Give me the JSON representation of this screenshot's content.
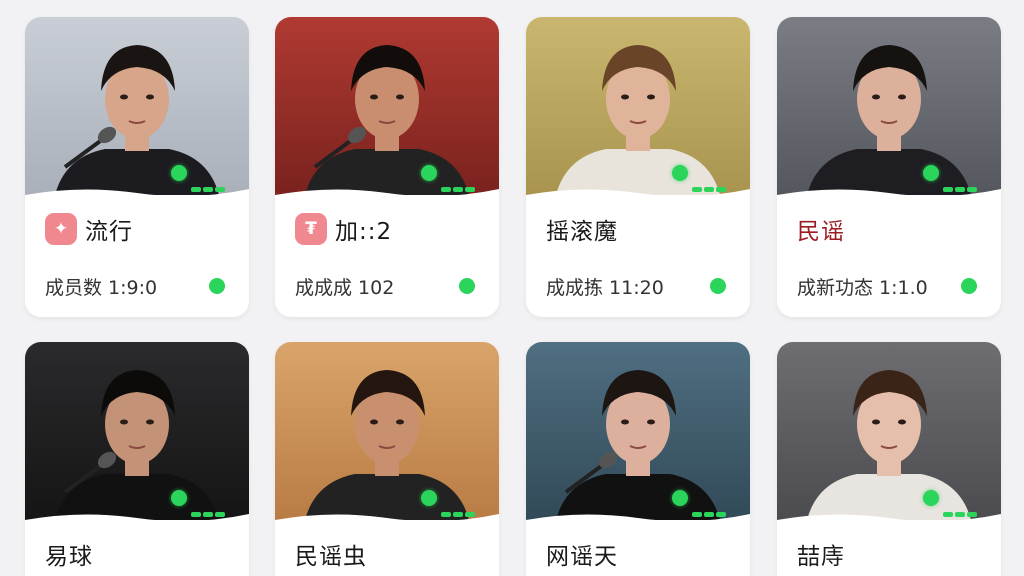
{
  "cards": [
    {
      "title": "流行",
      "icon_glyph": "✦",
      "has_icon": true,
      "stat": "成员数 1:9:0",
      "title_color": "#1a1a1a",
      "status": "online",
      "bg_top": "#c9ced6",
      "bg_bottom": "#a9b0ba",
      "shirt": "#1c1c20",
      "hair": "#1a1512",
      "skin": "#d6a58a",
      "has_mic": true
    },
    {
      "title": "加::2",
      "icon_glyph": "₮",
      "has_icon": true,
      "stat": "成成成 102",
      "title_color": "#1a1a1a",
      "status": "online",
      "bg_top": "#b03a32",
      "bg_bottom": "#7a221e",
      "shirt": "#222",
      "hair": "#120d0b",
      "skin": "#c98e70",
      "has_mic": true
    },
    {
      "title": "摇滚魔",
      "icon_glyph": "",
      "has_icon": false,
      "stat": "成成拣 11:20",
      "title_color": "#1a1a1a",
      "status": "online",
      "bg_top": "#c9b770",
      "bg_bottom": "#a8944e",
      "shirt": "#e8e4dc",
      "hair": "#6a4428",
      "skin": "#e0b49a",
      "has_mic": false
    },
    {
      "title": "民谣",
      "icon_glyph": "",
      "has_icon": false,
      "stat": "成新功态 1:1.0",
      "title_color": "#9b1c22",
      "status": "online",
      "bg_top": "#7a7d84",
      "bg_bottom": "#54575e",
      "shirt": "#1e1e22",
      "hair": "#16120f",
      "skin": "#dcb09a",
      "has_mic": false
    },
    {
      "title": "易球",
      "icon_glyph": "",
      "has_icon": false,
      "stat": "",
      "title_color": "#1a1a1a",
      "status": "online",
      "bg_top": "#2a2a2c",
      "bg_bottom": "#151516",
      "shirt": "#111",
      "hair": "#0d0b0a",
      "skin": "#c49276",
      "has_mic": true
    },
    {
      "title": "民谣虫",
      "icon_glyph": "",
      "has_icon": false,
      "stat": "",
      "title_color": "#1a1a1a",
      "status": "online",
      "bg_top": "#d9a46a",
      "bg_bottom": "#b97c44",
      "shirt": "#222",
      "hair": "#24160f",
      "skin": "#c99070",
      "has_mic": false
    },
    {
      "title": "网谣天",
      "icon_glyph": "",
      "has_icon": false,
      "stat": "",
      "title_color": "#1a1a1a",
      "status": "online",
      "bg_top": "#4f6f82",
      "bg_bottom": "#324a58",
      "shirt": "#111",
      "hair": "#1c1511",
      "skin": "#dcb09c",
      "has_mic": true
    },
    {
      "title": "喆庤",
      "icon_glyph": "",
      "has_icon": false,
      "stat": "",
      "title_color": "#1a1a1a",
      "status": "online",
      "bg_top": "#6e6e72",
      "bg_bottom": "#4c4c50",
      "shirt": "#e8e4e0",
      "hair": "#3a2418",
      "skin": "#e6bfac",
      "has_mic": false
    }
  ],
  "colors": {
    "online": "#2bd45a",
    "tag_bg": "#f0888f",
    "card_bg": "#ffffff",
    "page_bg": "#f2f2f4"
  }
}
